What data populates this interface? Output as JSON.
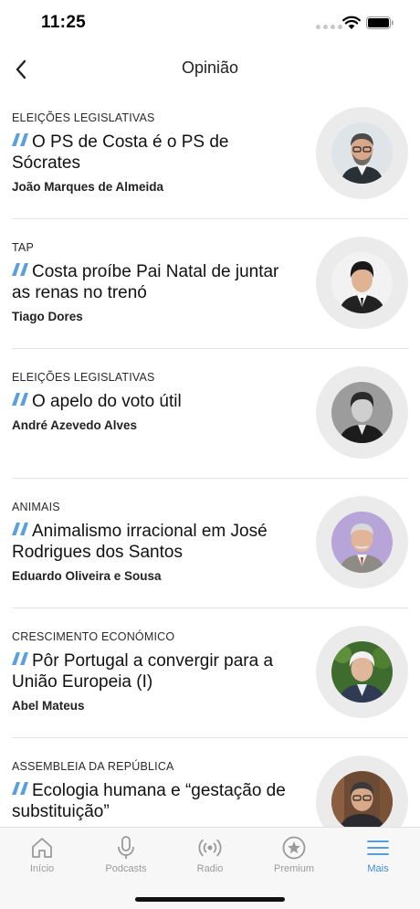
{
  "status_bar": {
    "time": "11:25"
  },
  "header": {
    "title": "Opinião"
  },
  "articles": [
    {
      "category": "ELEIÇÕES LEGISLATIVAS",
      "headline": "O PS de Costa é o PS de Sócrates",
      "author": "João Marques de Almeida"
    },
    {
      "category": "TAP",
      "headline": "Costa proíbe Pai Natal de juntar as renas no trenó",
      "author": "Tiago Dores"
    },
    {
      "category": "ELEIÇÕES LEGISLATIVAS",
      "headline": "O apelo do voto útil",
      "author": "André Azevedo Alves"
    },
    {
      "category": "ANIMAIS",
      "headline": "Animalismo irracional em José Rodrigues dos Santos",
      "author": "Eduardo Oliveira e Sousa"
    },
    {
      "category": "CRESCIMENTO ECONÓMICO",
      "headline": "Pôr Portugal a convergir para a União Europeia (I)",
      "author": "Abel Mateus"
    },
    {
      "category": "ASSEMBLEIA DA REPÚBLICA",
      "headline": "Ecologia humana e “gestação de substituição”",
      "author": ""
    }
  ],
  "tab_bar": {
    "tabs": [
      {
        "label": "Início",
        "icon": "home-icon"
      },
      {
        "label": "Podcasts",
        "icon": "microphone-icon"
      },
      {
        "label": "Radio",
        "icon": "radio-icon"
      },
      {
        "label": "Premium",
        "icon": "star-icon"
      },
      {
        "label": "Mais",
        "icon": "menu-icon",
        "active": true
      }
    ]
  },
  "colors": {
    "accent": "#3d8fd6",
    "quote": "#5aa0dc",
    "inactive": "#9a9a9a"
  }
}
